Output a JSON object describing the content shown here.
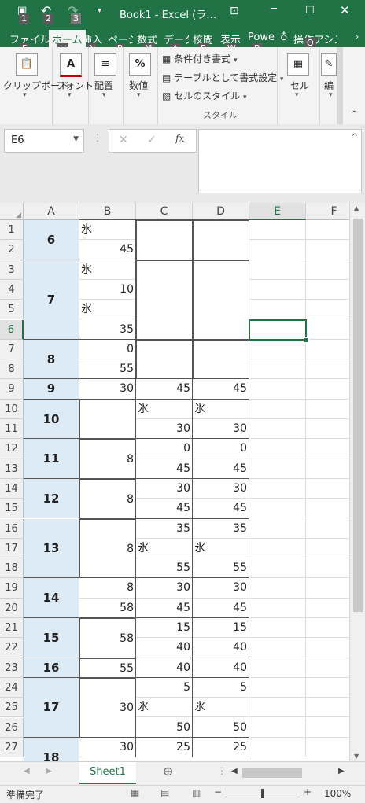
{
  "title": {
    "save_keytip": "1",
    "undo_keytip": "2",
    "redo_keytip": "3",
    "text": "Book1 - Excel (ラ…"
  },
  "tabs": [
    {
      "label": "ファイル",
      "keytip": "F"
    },
    {
      "label": "ホーム",
      "keytip": "H"
    },
    {
      "label": "挿入",
      "keytip": "N"
    },
    {
      "label": "ページ",
      "keytip": "P"
    },
    {
      "label": "数式",
      "keytip": "M"
    },
    {
      "label": "データ",
      "keytip": "A"
    },
    {
      "label": "校閲",
      "keytip": "R"
    },
    {
      "label": "表示",
      "keytip": "W"
    },
    {
      "label": "Powe",
      "keytip": "B"
    },
    {
      "label": "操作アシス",
      "keytip": "Q"
    }
  ],
  "ribbon": {
    "clipboard": "クリップボード",
    "font": "フォント",
    "alignment": "配置",
    "number": "数値",
    "cond_format": "条件付き書式",
    "table_format": "テーブルとして書式設定",
    "cell_style": "セルのスタイル",
    "styles_group": "スタイル",
    "cells": "セル",
    "edit": "編"
  },
  "namebox": "E6",
  "columns": [
    "A",
    "B",
    "C",
    "D",
    "E",
    "F"
  ],
  "rows": [
    "1",
    "2",
    "3",
    "4",
    "5",
    "6",
    "7",
    "8",
    "9",
    "10",
    "11",
    "12",
    "13",
    "14",
    "15",
    "16",
    "17",
    "18",
    "19",
    "20",
    "21",
    "22",
    "23",
    "24",
    "25",
    "26",
    "27"
  ],
  "cells": {
    "A1": "6",
    "A3": "7",
    "A7": "8",
    "A9": "9",
    "A10": "10",
    "A12": "11",
    "A14": "12",
    "A16": "13",
    "A19": "14",
    "A21": "15",
    "A23": "16",
    "A24": "17",
    "A27": "18",
    "B1": "氷",
    "B2": "45",
    "B3": "氷",
    "B4": "10",
    "B5": "氷",
    "B6": "35",
    "B7": "0",
    "B8": "55",
    "B9": "30",
    "B12": "8",
    "B14": "8",
    "B16": "8",
    "B19": "8",
    "B20": "58",
    "B21": "58",
    "B23": "55",
    "B24": "30",
    "B27": "30",
    "C9": "45",
    "C10": "氷",
    "C11": "30",
    "C12": "0",
    "C13": "45",
    "C14": "30",
    "C15": "45",
    "C16": "35",
    "C17": "氷",
    "C18": "55",
    "C19": "30",
    "C20": "45",
    "C21": "15",
    "C22": "40",
    "C23": "40",
    "C24": "5",
    "C25": "氷",
    "C26": "50",
    "C27": "25",
    "D9": "45",
    "D10": "氷",
    "D11": "30",
    "D12": "0",
    "D13": "45",
    "D14": "30",
    "D15": "45",
    "D16": "35",
    "D17": "氷",
    "D18": "55",
    "D19": "30",
    "D20": "45",
    "D21": "15",
    "D22": "40",
    "D23": "40",
    "D24": "5",
    "D25": "氷",
    "D26": "50",
    "D27": "25"
  },
  "sheet_tab": "Sheet1",
  "status": "準備完了",
  "zoom": "100%"
}
